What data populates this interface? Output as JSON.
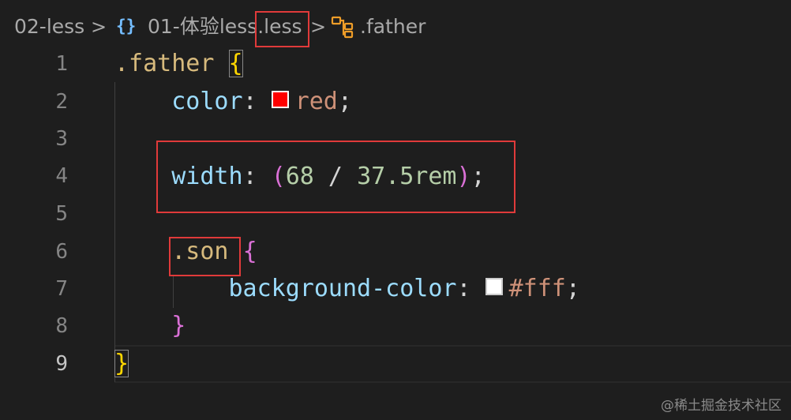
{
  "breadcrumb": {
    "folder": "02-less",
    "file_icon": "braces-icon",
    "file": "01-体验less.less",
    "symbol_icon": "symbol-class-icon",
    "symbol": ".father",
    "separator": ">"
  },
  "editor": {
    "line_numbers": [
      "1",
      "2",
      "3",
      "4",
      "5",
      "6",
      "7",
      "8",
      "9"
    ],
    "active_line": "9",
    "code": {
      "l1_selector": ".father",
      "l1_brace": "{",
      "l2_prop": "color",
      "l2_colon": ": ",
      "l2_swatch_color": "#ff0000",
      "l2_value": "red",
      "l2_semi": ";",
      "l4_prop": "width",
      "l4_colon": ": ",
      "l4_lparen": "(",
      "l4_num1": "68",
      "l4_op": " / ",
      "l4_num2": "37.5rem",
      "l4_rparen": ")",
      "l4_semi": ";",
      "l6_selector": ".son",
      "l6_brace": "{",
      "l7_prop": "background-color",
      "l7_colon": ": ",
      "l7_swatch_color": "#ffffff",
      "l7_value": "#fff",
      "l7_semi": ";",
      "l8_brace": "}",
      "l9_brace": "}"
    }
  },
  "colors": {
    "background": "#1e1e1e",
    "selector": "#d7ba7d",
    "property": "#9cdcfe",
    "string_value": "#ce9178",
    "number": "#b5cea8",
    "brace_level1": "#ffd700",
    "brace_level2": "#da70d6",
    "annotation_box": "#e03a3a"
  },
  "watermark": "@稀土掘金技术社区"
}
